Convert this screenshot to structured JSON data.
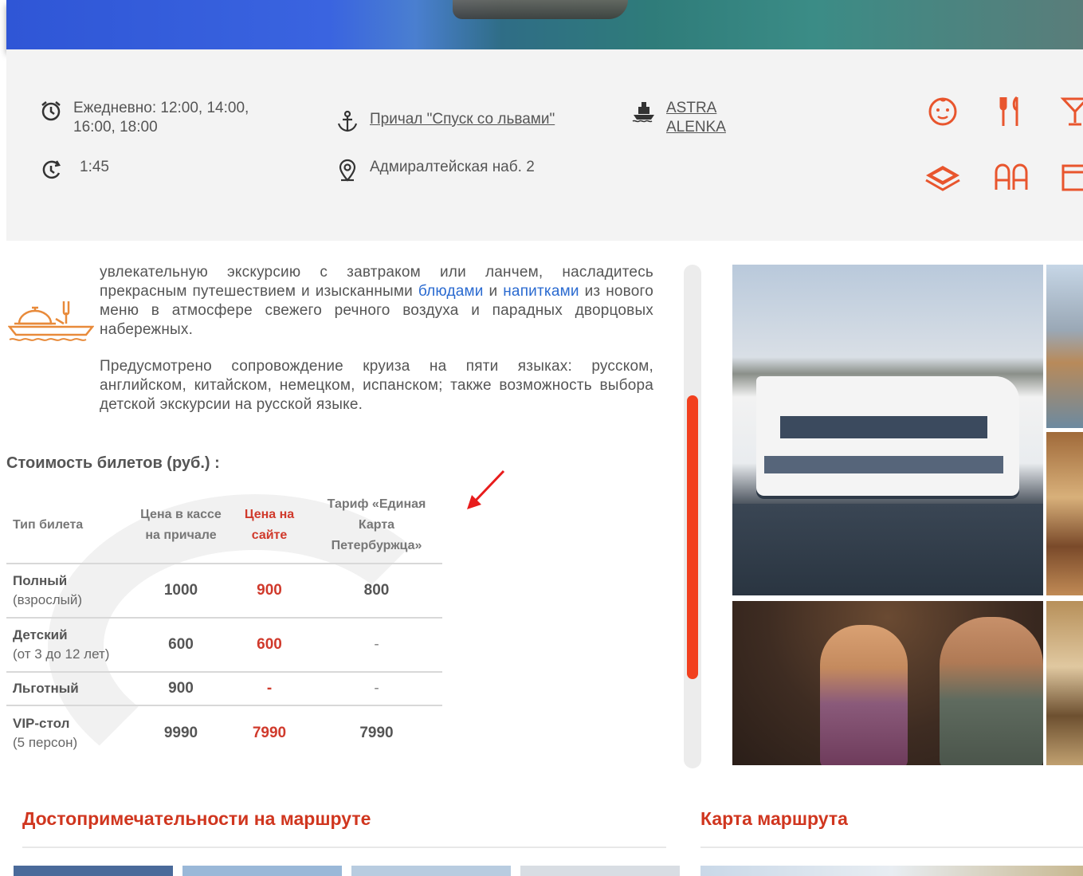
{
  "schedule": {
    "times": "Ежедневно: 12:00, 14:00, 16:00, 18:00",
    "duration": "1:45",
    "pier_link": "Причал \"Спуск со львами\"",
    "address": "Адмиралтейская наб. 2",
    "ship_name": "ASTRA ALENKA"
  },
  "features": [
    "baby-face-icon",
    "fork-knife-icon",
    "cocktail-icon",
    "deck-layers-icon",
    "language-icon",
    "ticket-icon"
  ],
  "description": {
    "p1_before": "увлекательную экскурсию с завтраком или ланчем, насладитесь прекрасным путешествием и изысканными",
    "link_dishes": "блюдами",
    "and": "и",
    "link_drinks": "напитками",
    "p1_after": "из нового меню в атмосфере свежего речного воздуха и парадных дворцовых набережных.",
    "p2": "Предусмотрено сопровождение круиза на пяти языках: русском, английском, китайском, немецком, испанском; также возможность выбора детской экскурсии на русской языке."
  },
  "prices": {
    "title": "Стоимость билетов (руб.) :",
    "headers": {
      "type": "Тип билета",
      "box_office": "Цена в кассе на причале",
      "site": "Цена на сайте",
      "card": "Тариф «Единая Карта Петербуржца»"
    },
    "rows": [
      {
        "name": "Полный",
        "sub": "(взрослый)",
        "box": "1000",
        "site": "900",
        "card": "800"
      },
      {
        "name": "Детский",
        "sub": "(от 3 до 12 лет)",
        "box": "600",
        "site": "600",
        "card": "-"
      },
      {
        "name": "Льготный",
        "sub": "",
        "box": "900",
        "site": "-",
        "card": "-"
      },
      {
        "name": "VIP-стол",
        "sub": "(5 персон)",
        "box": "9990",
        "site": "7990",
        "card": "7990"
      }
    ]
  },
  "sections": {
    "sights": "Достопримечательности на маршруте",
    "map": "Карта маршрута"
  },
  "colors": {
    "accent": "#d0361f",
    "icon_orange": "#e8552d",
    "scroll_thumb": "#f2401e",
    "link_blue": "#2a6ad0"
  }
}
